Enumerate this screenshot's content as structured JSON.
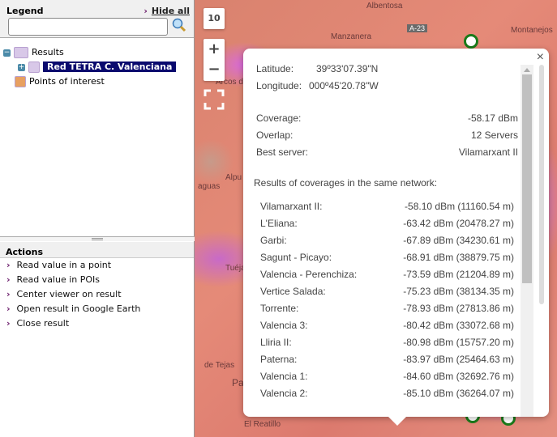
{
  "legend": {
    "title": "Legend",
    "hide_all": "Hide all",
    "search_value": "",
    "tree": {
      "results": "Results",
      "network": "Red TETRA C. Valenciana",
      "poi": "Points of interest"
    }
  },
  "actions": {
    "title": "Actions",
    "items": [
      "Read value in a point",
      "Read value in POIs",
      "Center viewer on result",
      "Open result in Google Earth",
      "Close result"
    ]
  },
  "map": {
    "zoom_level": "10",
    "zoom_in": "+",
    "zoom_out": "−",
    "labels": [
      "Albentosa",
      "Manzanera",
      "A-23",
      "Montanejos",
      "Arcos de las",
      "Alpu",
      "aguas",
      "Tuéjar",
      "de Tejas",
      "El Reatillo",
      "Pa"
    ],
    "colors": {
      "coverage_high": "#e070e0",
      "coverage_low": "#e58a78",
      "pin": "#1a7a1a"
    }
  },
  "popup": {
    "latitude_label": "Latitude:",
    "latitude": "39º33'07.39\"N",
    "longitude_label": "Longitude:",
    "longitude": "000º45'20.78\"W",
    "coverage_label": "Coverage:",
    "coverage": "-58.17 dBm",
    "overlap_label": "Overlap:",
    "overlap": "12 Servers",
    "best_label": "Best server:",
    "best": "Vilamarxant II",
    "results_title": "Results of coverages in the same network:",
    "results": [
      {
        "name": "Vilamarxant II:",
        "value": "-58.10 dBm (11160.54 m)"
      },
      {
        "name": "L'Eliana:",
        "value": "-63.42 dBm (20478.27 m)"
      },
      {
        "name": "Garbi:",
        "value": "-67.89 dBm (34230.61 m)"
      },
      {
        "name": "Sagunt - Picayo:",
        "value": "-68.91 dBm (38879.75 m)"
      },
      {
        "name": "Valencia - Perenchiza:",
        "value": "-73.59 dBm (21204.89 m)"
      },
      {
        "name": "Vertice Salada:",
        "value": "-75.23 dBm (38134.35 m)"
      },
      {
        "name": "Torrente:",
        "value": "-78.93 dBm (27813.86 m)"
      },
      {
        "name": "Valencia 3:",
        "value": "-80.42 dBm (33072.68 m)"
      },
      {
        "name": "Lliria II:",
        "value": "-80.98 dBm (15757.20 m)"
      },
      {
        "name": "Paterna:",
        "value": "-83.97 dBm (25464.63 m)"
      },
      {
        "name": "Valencia 1:",
        "value": "-84.60 dBm (32692.76 m)"
      },
      {
        "name": "Valencia 2:",
        "value": "-85.10 dBm (36264.07 m)"
      }
    ]
  }
}
